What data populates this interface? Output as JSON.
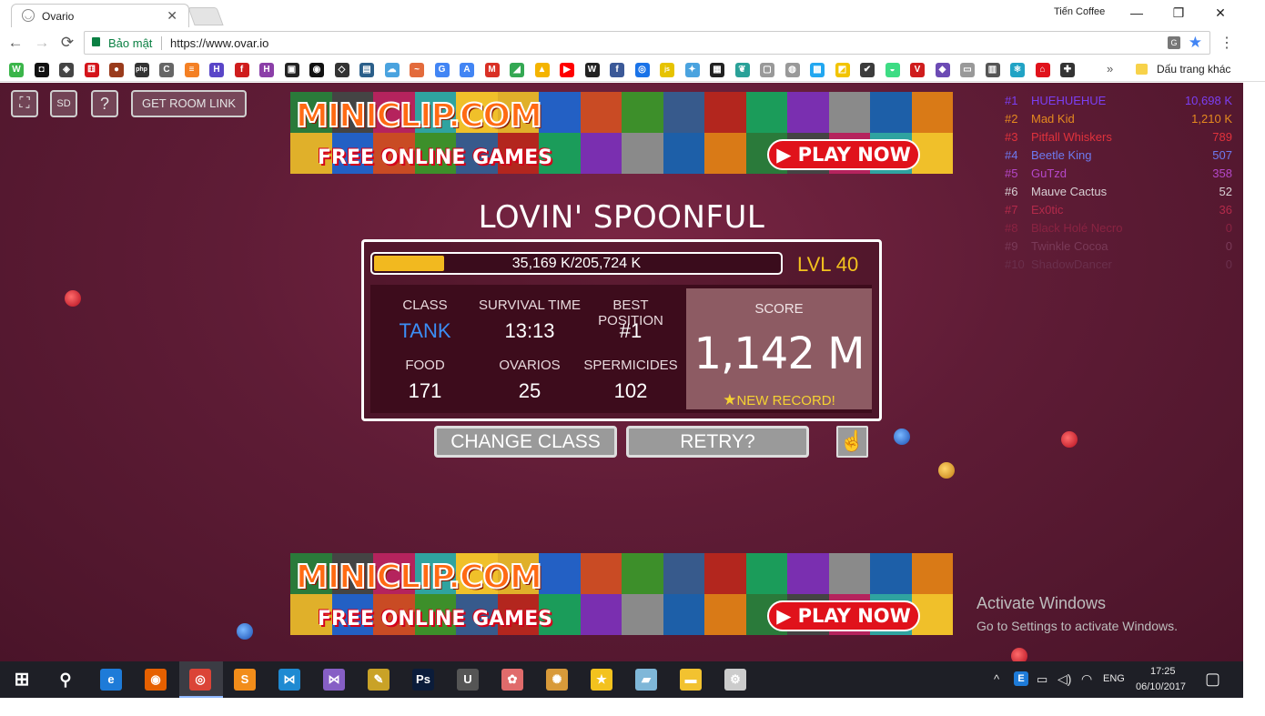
{
  "browser": {
    "tab_title": "Ovario",
    "tab_close": "✕",
    "profile_name": "Tiến Coffee",
    "window_controls": {
      "minimize": "—",
      "maximize": "❐",
      "close": "✕"
    },
    "nav": {
      "back": "←",
      "forward": "→",
      "reload": "⟳"
    },
    "secure_label": "Bảo mật",
    "url": "https://www.ovar.io",
    "translate_icon": "G",
    "bookmark_star": "★",
    "menu": "⋮",
    "bookmarks_more": "»",
    "other_bookmarks": "Dấu trang khác",
    "bookmark_icons": [
      {
        "name": "wikia-icon",
        "glyph": "W",
        "color": "#3bb54a"
      },
      {
        "name": "fullscreen-site-icon",
        "glyph": "◘",
        "color": "#111111"
      },
      {
        "name": "diamond-icon",
        "glyph": "◈",
        "color": "#444444"
      },
      {
        "name": "dice-icon",
        "glyph": "⚅",
        "color": "#d4141a"
      },
      {
        "name": "avatar-bookmark-icon",
        "glyph": "●",
        "color": "#9a3b1c"
      },
      {
        "name": "php-icon",
        "glyph": "php",
        "color": "#333333"
      },
      {
        "name": "c-icon",
        "glyph": "C",
        "color": "#666666"
      },
      {
        "name": "stackoverflow-icon",
        "glyph": "≡",
        "color": "#f48024"
      },
      {
        "name": "h-icon",
        "glyph": "H",
        "color": "#5a46c8"
      },
      {
        "name": "f-icon",
        "glyph": "f",
        "color": "#cf1d1d"
      },
      {
        "name": "heroku-icon",
        "glyph": "H",
        "color": "#8b3fa8"
      },
      {
        "name": "cam-icon",
        "glyph": "▣",
        "color": "#222222"
      },
      {
        "name": "github-icon",
        "glyph": "◉",
        "color": "#111111"
      },
      {
        "name": "codepen-icon",
        "glyph": "◇",
        "color": "#333333"
      },
      {
        "name": "terminal-icon",
        "glyph": "▤",
        "color": "#2b5f8a"
      },
      {
        "name": "cloud-icon",
        "glyph": "☁",
        "color": "#4aa3df"
      },
      {
        "name": "wave-icon",
        "glyph": "~",
        "color": "#e36b3c"
      },
      {
        "name": "google-icon",
        "glyph": "G",
        "color": "#4285f4"
      },
      {
        "name": "translate-bm-icon",
        "glyph": "A",
        "color": "#4285f4"
      },
      {
        "name": "gmail-icon",
        "glyph": "M",
        "color": "#d93025"
      },
      {
        "name": "maps-icon",
        "glyph": "◢",
        "color": "#34a853"
      },
      {
        "name": "drive-icon",
        "glyph": "▲",
        "color": "#f4b400"
      },
      {
        "name": "youtube-icon",
        "glyph": "▶",
        "color": "#ff0000"
      },
      {
        "name": "wikipedia-icon",
        "glyph": "W",
        "color": "#222222"
      },
      {
        "name": "facebook-icon",
        "glyph": "f",
        "color": "#3b5998"
      },
      {
        "name": "chrome-icon",
        "glyph": "◎",
        "color": "#1a73e8"
      },
      {
        "name": "js-icon",
        "glyph": "js",
        "color": "#e6c300"
      },
      {
        "name": "ufo-icon",
        "glyph": "✦",
        "color": "#4aa3df"
      },
      {
        "name": "gamedev-icon",
        "glyph": "▦",
        "color": "#222222"
      },
      {
        "name": "leaf-icon",
        "glyph": "❦",
        "color": "#2aa198"
      },
      {
        "name": "page-icon",
        "glyph": "▢",
        "color": "#999999"
      },
      {
        "name": "chromium-icon",
        "glyph": "◍",
        "color": "#999999"
      },
      {
        "name": "tiles-icon",
        "glyph": "▩",
        "color": "#22a7f0"
      },
      {
        "name": "sticky-icon",
        "glyph": "◩",
        "color": "#f2c400"
      },
      {
        "name": "check-icon",
        "glyph": "✔",
        "color": "#3c3c3c"
      },
      {
        "name": "android-icon",
        "glyph": "◒",
        "color": "#3ddc84"
      },
      {
        "name": "vivaldi-icon",
        "glyph": "V",
        "color": "#cf1d1d"
      },
      {
        "name": "gem-icon",
        "glyph": "◆",
        "color": "#6c4bb4"
      },
      {
        "name": "doc-icon",
        "glyph": "▭",
        "color": "#999999"
      },
      {
        "name": "counter-icon",
        "glyph": "▥",
        "color": "#555555"
      },
      {
        "name": "react-icon",
        "glyph": "⚛",
        "color": "#21a3c5"
      },
      {
        "name": "red-house-icon",
        "glyph": "⌂",
        "color": "#e0121b"
      },
      {
        "name": "puzzle-icon",
        "glyph": "✚",
        "color": "#333333"
      }
    ]
  },
  "game": {
    "toolbar": {
      "fullscreen_icon": "⛶",
      "sd_label": "SD",
      "help_label": "?",
      "room_link_label": "GET ROOM LINK"
    },
    "ads": {
      "brand": "MINICLIP.COM",
      "free_text": "FREE ONLINE GAMES",
      "play_text": "▶ PLAY NOW"
    },
    "leaderboard": [
      {
        "rank": "#1",
        "name": "HUEHUEHUE",
        "score": "10,698 K",
        "color": "#7b3ff2"
      },
      {
        "rank": "#2",
        "name": "Mad Kid",
        "score": "1,210 K",
        "color": "#e58a1f"
      },
      {
        "rank": "#3",
        "name": "Pitfall Whiskers",
        "score": "789",
        "color": "#e0323c"
      },
      {
        "rank": "#4",
        "name": "Beetle King",
        "score": "507",
        "color": "#6d7af0"
      },
      {
        "rank": "#5",
        "name": "GuTzd",
        "score": "358",
        "color": "#b548c9"
      },
      {
        "rank": "#6",
        "name": "Mauve Cactus",
        "score": "52",
        "color": "#d8d0d4"
      },
      {
        "rank": "#7",
        "name": "Ex0tic",
        "score": "36",
        "color": "#b32a4a"
      },
      {
        "rank": "#8",
        "name": "Black Holé Necro",
        "score": "0",
        "color": "#8a2342"
      },
      {
        "rank": "#9",
        "name": "Twinkle Cocoa",
        "score": "0",
        "color": "#7a3a58"
      },
      {
        "rank": "#10",
        "name": "ShadowDancer",
        "score": "0",
        "color": "#6a2f4c"
      }
    ],
    "death_title": "LOVIN' SPOONFUL",
    "xp": {
      "text": "35,169 K/205,724 K",
      "fraction": 0.171
    },
    "level": "LVL 40",
    "stats": {
      "class_label": "CLASS",
      "class_value": "TANK",
      "survival_label": "SURVIVAL TIME",
      "survival_value": "13:13",
      "best_label": "BEST POSITION",
      "best_value": "#1",
      "food_label": "FOOD",
      "food_value": "171",
      "ovarios_label": "OVARIOS",
      "ovarios_value": "25",
      "spermicides_label": "SPERMICIDES",
      "spermicides_value": "102"
    },
    "score": {
      "label": "SCORE",
      "value": "1,142 M",
      "record_star": "★",
      "record_text": "NEW RECORD!"
    },
    "buttons": {
      "change_class": "CHANGE CLASS",
      "retry": "RETRY?",
      "like_icon": "☝"
    },
    "watermark": {
      "line1": "Activate Windows",
      "line2": "Go to Settings to activate Windows."
    }
  },
  "taskbar": {
    "start_icon": "⊞",
    "search_icon": "⚲",
    "apps": [
      {
        "name": "edge-icon",
        "glyph": "e",
        "color": "#1e7bd8"
      },
      {
        "name": "firefox-icon",
        "glyph": "◉",
        "color": "#e66000"
      },
      {
        "name": "chrome-taskbar-icon",
        "glyph": "◎",
        "color": "#db4437"
      },
      {
        "name": "sublime-icon",
        "glyph": "S",
        "color": "#f28d1a"
      },
      {
        "name": "vscode-icon",
        "glyph": "⋈",
        "color": "#1f8ad2"
      },
      {
        "name": "visual-studio-icon",
        "glyph": "⋈",
        "color": "#865fc5"
      },
      {
        "name": "tools-icon",
        "glyph": "✎",
        "color": "#c9a227"
      },
      {
        "name": "photoshop-icon",
        "glyph": "Ps",
        "color": "#0b1c3a"
      },
      {
        "name": "unikey-icon",
        "glyph": "U",
        "color": "#555555"
      },
      {
        "name": "paint-icon",
        "glyph": "✿",
        "color": "#e06b6b"
      },
      {
        "name": "palette-icon",
        "glyph": "✺",
        "color": "#d89a3a"
      },
      {
        "name": "star-app-icon",
        "glyph": "★",
        "color": "#f3c21e"
      },
      {
        "name": "notes-icon",
        "glyph": "▰",
        "color": "#7fb7d8"
      },
      {
        "name": "explorer-icon",
        "glyph": "▬",
        "color": "#f2c230"
      },
      {
        "name": "settings-icon",
        "glyph": "⚙",
        "color": "#cccccc"
      }
    ],
    "tray": {
      "chevron": "^",
      "lang": "ENG",
      "time": "17:25",
      "date": "06/10/2017",
      "notifications_icon": "▢"
    }
  }
}
